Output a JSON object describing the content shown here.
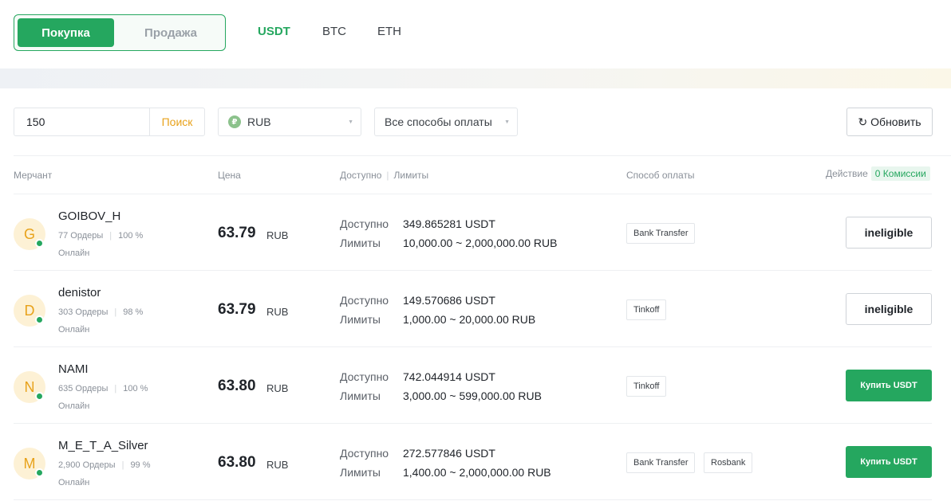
{
  "side_toggle": {
    "buy_label": "Покупка",
    "sell_label": "Продажа"
  },
  "coin_tabs": [
    "USDT",
    "BTC",
    "ETH"
  ],
  "filters": {
    "amount_value": "150",
    "search_label": "Поиск",
    "currency_icon": "₽",
    "currency": "RUB",
    "payment_method": "Все способы оплаты",
    "refresh_label": "Обновить"
  },
  "table_headers": {
    "merchant": "Мерчант",
    "price": "Цена",
    "available": "Доступно",
    "limits": "Лимиты",
    "payment": "Способ оплаты",
    "action": "Действие",
    "fee_badge": "0 Комиссии"
  },
  "rows": [
    {
      "initial": "G",
      "name": "GOIBOV_H",
      "orders": "77 Ордеры",
      "completion": "100 %",
      "status": "Онлайн",
      "price": "63.79",
      "price_currency": "RUB",
      "available_label": "Доступно",
      "available": "349.865281 USDT",
      "limits_label": "Лимиты",
      "limits": "10,000.00 ~ 2,000,000.00 RUB",
      "payments": [
        "Bank Transfer"
      ],
      "action": "ineligible",
      "action_type": "ineligible"
    },
    {
      "initial": "D",
      "name": "denistor",
      "orders": "303 Ордеры",
      "completion": "98 %",
      "status": "Онлайн",
      "price": "63.79",
      "price_currency": "RUB",
      "available_label": "Доступно",
      "available": "149.570686 USDT",
      "limits_label": "Лимиты",
      "limits": "1,000.00 ~ 20,000.00 RUB",
      "payments": [
        "Tinkoff"
      ],
      "action": "ineligible",
      "action_type": "ineligible"
    },
    {
      "initial": "N",
      "name": "NAMI",
      "orders": "635 Ордеры",
      "completion": "100 %",
      "status": "Онлайн",
      "price": "63.80",
      "price_currency": "RUB",
      "available_label": "Доступно",
      "available": "742.044914 USDT",
      "limits_label": "Лимиты",
      "limits": "3,000.00 ~ 599,000.00 RUB",
      "payments": [
        "Tinkoff"
      ],
      "action": "Купить USDT",
      "action_type": "buy"
    },
    {
      "initial": "M",
      "name": "M_E_T_A_Silver",
      "orders": "2,900 Ордеры",
      "completion": "99 %",
      "status": "Онлайн",
      "price": "63.80",
      "price_currency": "RUB",
      "available_label": "Доступно",
      "available": "272.577846 USDT",
      "limits_label": "Лимиты",
      "limits": "1,400.00 ~ 2,000,000.00 RUB",
      "payments": [
        "Bank Transfer",
        "Rosbank"
      ],
      "action": "Купить USDT",
      "action_type": "buy"
    }
  ],
  "colors": {
    "accent": "#25a75f",
    "search": "#e8a21b",
    "avatar_bg": "#fdf1d5"
  }
}
